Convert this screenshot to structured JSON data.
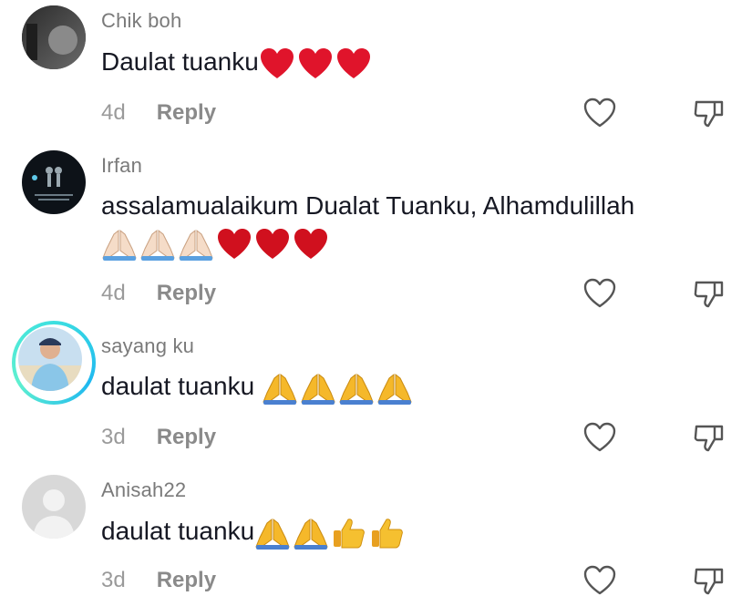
{
  "comments": [
    {
      "username": "Chik boh",
      "text": "Daulat tuanku",
      "emojis": [
        "heart",
        "heart",
        "heart"
      ],
      "time": "4d",
      "reply": "Reply",
      "avatar": "night-photo"
    },
    {
      "username": "Irfan",
      "text": "assalamualaikum Dualat Tuanku, Alhamdulillah",
      "emojis": [
        "pray-light",
        "pray-light",
        "pray-light",
        "heart",
        "heart",
        "heart"
      ],
      "time": "4d",
      "reply": "Reply",
      "avatar": "dark-photo"
    },
    {
      "username": "sayang ku",
      "text": "daulat tuanku",
      "emojis": [
        "pray",
        "pray",
        "pray",
        "pray"
      ],
      "time": "3d",
      "reply": "Reply",
      "avatar": "person-photo"
    },
    {
      "username": "Anisah22",
      "text": "daulat tuanku",
      "emojis": [
        "pray",
        "pray",
        "thumbs-up",
        "thumbs-up"
      ],
      "time": "3d",
      "reply": "Reply",
      "avatar": "default-avatar"
    }
  ],
  "colors": {
    "text": "#161823",
    "username": "#7a7a7a",
    "meta": "#9a9a9a",
    "heart": "#e0142b",
    "ring": "#1fb8f0"
  }
}
